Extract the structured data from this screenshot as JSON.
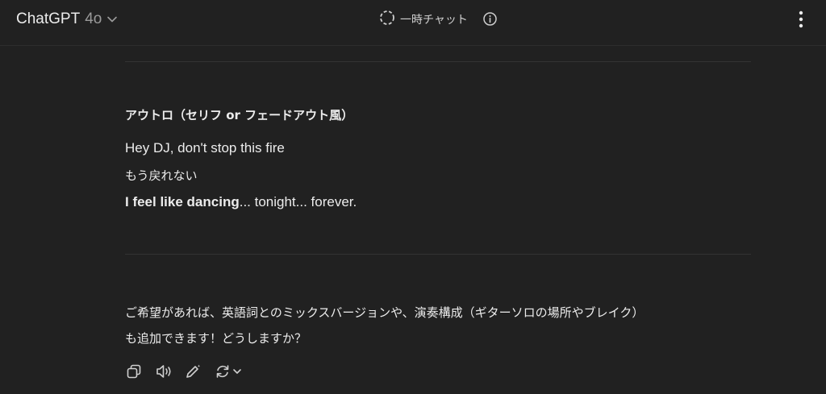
{
  "header": {
    "model_name": "ChatGPT",
    "model_version": "4o",
    "temp_chat_label": "一時チャット"
  },
  "message": {
    "heading": "アウトロ（セリフ or フェードアウト風）",
    "line1": "Hey DJ, don't stop this fire",
    "line2": "もう戻れない",
    "line3_bold": "I feel like dancing",
    "line3_rest": "... tonight... forever.",
    "followup_line1": "ご希望があれば、英語詞とのミックスバージョンや、演奏構成（ギターソロの場所やブレイク）",
    "followup_line2": "も追加できます！どうしますか？"
  },
  "actions": {
    "icons": [
      "copy-icon",
      "speaker-icon",
      "edit-icon",
      "regenerate-icon",
      "chevron-down-icon"
    ]
  },
  "colors": {
    "background": "#212121",
    "text": "#ececec",
    "muted": "#9a9a9a",
    "divider": "#333333"
  }
}
